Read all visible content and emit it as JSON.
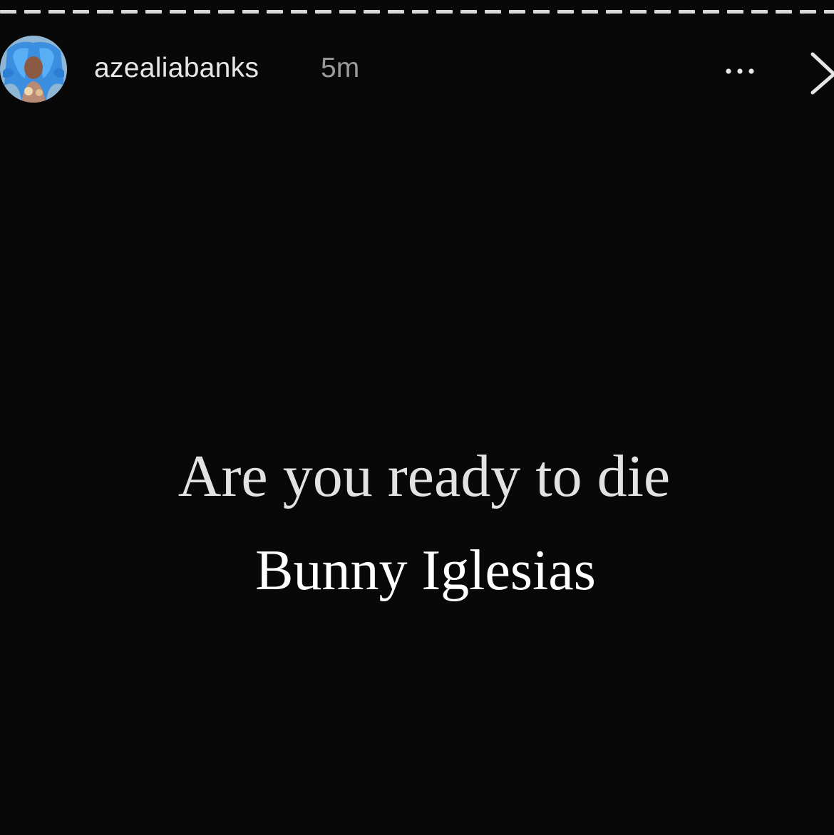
{
  "story": {
    "username": "azealiabanks",
    "timestamp": "5m",
    "headline": "Are you ready to die",
    "caption": "Bunny Iglesias"
  },
  "header": {
    "more_icon": "more-horizontal-icon",
    "close_icon": "close-icon",
    "avatar_icon": "profile-avatar"
  },
  "colors": {
    "background": "#080808",
    "text_primary": "#e2e2e2",
    "text_secondary": "#9a9a9a",
    "progress": "#d9d9d9"
  }
}
